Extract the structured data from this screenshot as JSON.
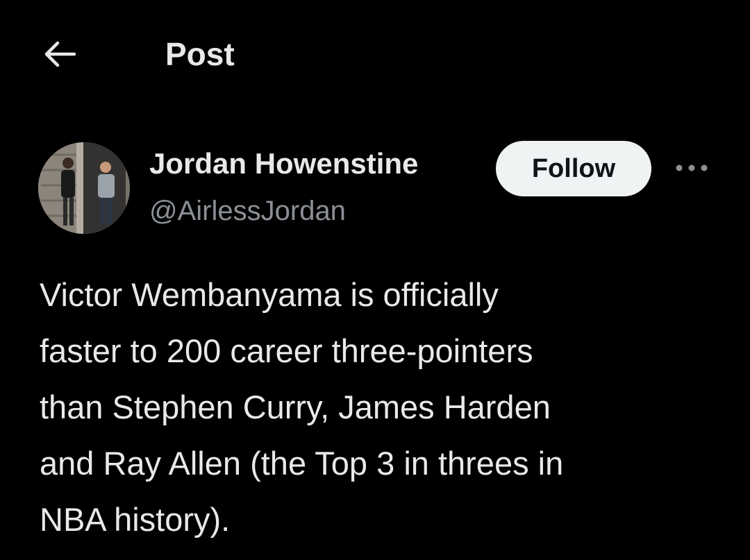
{
  "header": {
    "back_icon": "arrow-left-icon",
    "title": "Post"
  },
  "author": {
    "display_name": "Jordan Howenstine",
    "handle": "@AirlessJordan",
    "avatar_icon": "profile-photo"
  },
  "actions": {
    "follow_label": "Follow",
    "more_icon": "more-horizontal-icon"
  },
  "post": {
    "text": "Victor Wembanyama is officially\nfaster to 200 career three-pointers\nthan Stephen Curry, James Harden\nand Ray Allen (the Top 3 in threes in\nNBA history)."
  },
  "colors": {
    "background": "#000000",
    "primary_text": "#e7e9ea",
    "secondary_text": "#8b9096",
    "follow_bg": "#eff3f4",
    "follow_text": "#0f1419"
  }
}
